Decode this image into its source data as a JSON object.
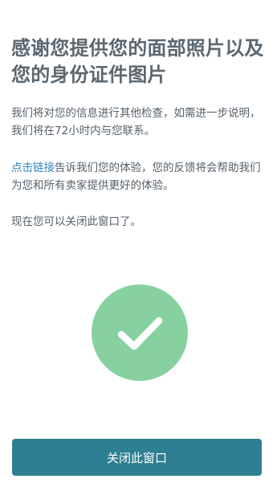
{
  "title": "感谢您提供您的面部照片以及您的身份证件图片",
  "paragraph_1": "我们将对您的信息进行其他检查，如需进一步说明，我们将在72小时内与您联系。",
  "paragraph_2": {
    "link_text": "点击链接",
    "text": "告诉我们您的体验，您的反馈将会帮助我们为您和所有卖家提供更好的体验。"
  },
  "paragraph_3": "现在您可以关闭此窗口了。",
  "status_icon": "checkmark-icon",
  "colors": {
    "title": "#5b6770",
    "body_text": "#55606a",
    "link": "#2e86c1",
    "success_circle": "#87d1a0",
    "button_bg": "#2e7f92",
    "button_text": "#ffffff"
  },
  "close_button": {
    "label": "关闭此窗口"
  }
}
